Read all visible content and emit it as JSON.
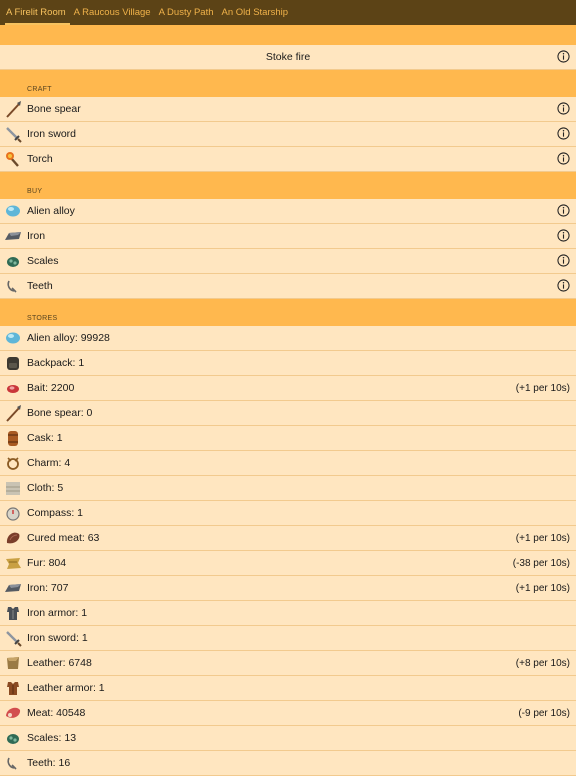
{
  "tabs": [
    {
      "label": "A Firelit Room",
      "active": true
    },
    {
      "label": "A Raucous Village",
      "active": false
    },
    {
      "label": "A Dusty Path",
      "active": false
    },
    {
      "label": "An Old Starship",
      "active": false
    }
  ],
  "stoke": {
    "label": "Stoke fire"
  },
  "craft": {
    "header": "CRAFT",
    "items": [
      {
        "label": "Bone spear",
        "icon": "bone-spear-icon"
      },
      {
        "label": "Iron sword",
        "icon": "iron-sword-icon"
      },
      {
        "label": "Torch",
        "icon": "torch-icon"
      }
    ]
  },
  "buy": {
    "header": "BUY",
    "items": [
      {
        "label": "Alien alloy",
        "icon": "alien-alloy-icon"
      },
      {
        "label": "Iron",
        "icon": "iron-icon"
      },
      {
        "label": "Scales",
        "icon": "scales-icon"
      },
      {
        "label": "Teeth",
        "icon": "teeth-icon"
      }
    ]
  },
  "stores": {
    "header": "STORES",
    "items": [
      {
        "label": "Alien alloy: 99928",
        "rate": "",
        "icon": "alien-alloy-icon"
      },
      {
        "label": "Backpack: 1",
        "rate": "",
        "icon": "backpack-icon"
      },
      {
        "label": "Bait: 2200",
        "rate": "(+1 per 10s)",
        "icon": "bait-icon"
      },
      {
        "label": "Bone spear: 0",
        "rate": "",
        "icon": "bone-spear-icon"
      },
      {
        "label": "Cask: 1",
        "rate": "",
        "icon": "cask-icon"
      },
      {
        "label": "Charm: 4",
        "rate": "",
        "icon": "charm-icon"
      },
      {
        "label": "Cloth: 5",
        "rate": "",
        "icon": "cloth-icon"
      },
      {
        "label": "Compass: 1",
        "rate": "",
        "icon": "compass-icon"
      },
      {
        "label": "Cured meat: 63",
        "rate": "(+1 per 10s)",
        "icon": "cured-meat-icon"
      },
      {
        "label": "Fur: 804",
        "rate": "(-38 per 10s)",
        "icon": "fur-icon"
      },
      {
        "label": "Iron: 707",
        "rate": "(+1 per 10s)",
        "icon": "iron-icon"
      },
      {
        "label": "Iron armor: 1",
        "rate": "",
        "icon": "iron-armor-icon"
      },
      {
        "label": "Iron sword: 1",
        "rate": "",
        "icon": "iron-sword-icon"
      },
      {
        "label": "Leather: 6748",
        "rate": "(+8 per 10s)",
        "icon": "leather-icon"
      },
      {
        "label": "Leather armor: 1",
        "rate": "",
        "icon": "leather-armor-icon"
      },
      {
        "label": "Meat: 40548",
        "rate": "(-9 per 10s)",
        "icon": "meat-icon"
      },
      {
        "label": "Scales: 13",
        "rate": "",
        "icon": "scales-icon"
      },
      {
        "label": "Teeth: 16",
        "rate": "",
        "icon": "teeth-icon"
      }
    ]
  }
}
